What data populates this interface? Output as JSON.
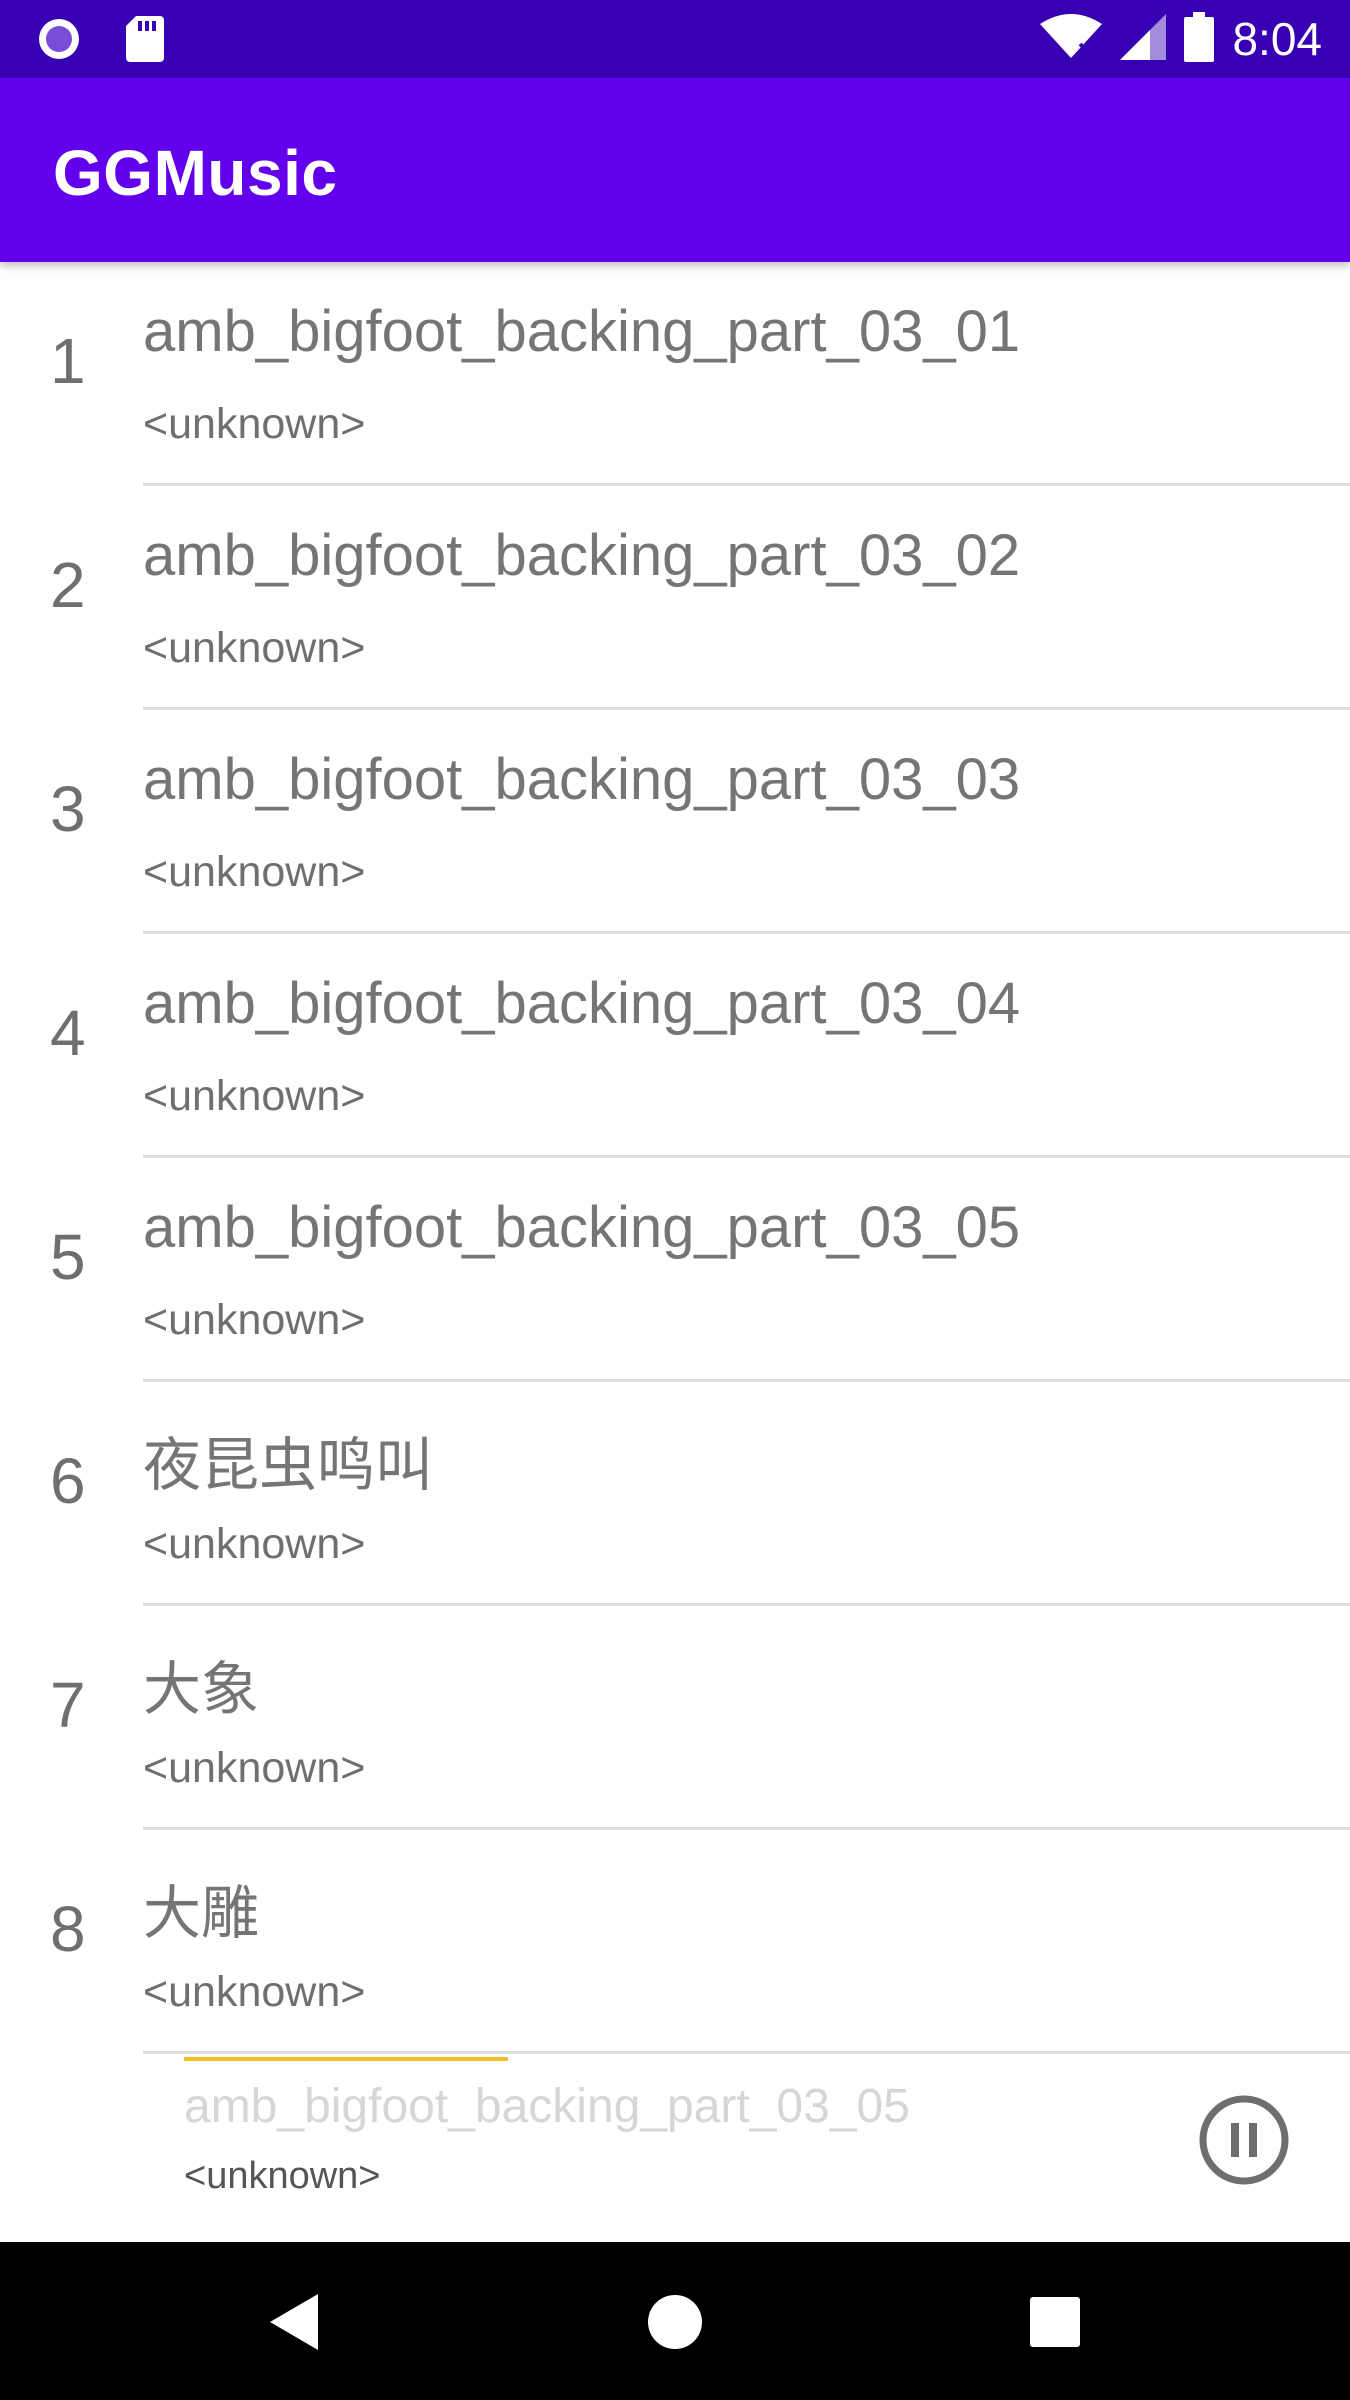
{
  "status_bar": {
    "time": "8:04",
    "icons": [
      "notification-circle-icon",
      "sd-card-icon",
      "wifi-icon",
      "signal-icon",
      "battery-icon"
    ]
  },
  "app_bar": {
    "title": "GGMusic"
  },
  "songs": [
    {
      "index": "1",
      "title": "amb_bigfoot_backing_part_03_01",
      "artist": "<unknown>"
    },
    {
      "index": "2",
      "title": "amb_bigfoot_backing_part_03_02",
      "artist": "<unknown>"
    },
    {
      "index": "3",
      "title": "amb_bigfoot_backing_part_03_03",
      "artist": "<unknown>"
    },
    {
      "index": "4",
      "title": "amb_bigfoot_backing_part_03_04",
      "artist": "<unknown>"
    },
    {
      "index": "5",
      "title": "amb_bigfoot_backing_part_03_05",
      "artist": "<unknown>"
    },
    {
      "index": "6",
      "title": "夜昆虫鸣叫",
      "artist": "<unknown>"
    },
    {
      "index": "7",
      "title": "大象",
      "artist": "<unknown>"
    },
    {
      "index": "8",
      "title": "大雕",
      "artist": "<unknown>"
    }
  ],
  "now_playing": {
    "title": "amb_bigfoot_backing_part_03_05",
    "artist": "<unknown>",
    "progress": 0.24,
    "button_icon": "pause-icon"
  },
  "nav_bar": {
    "icons": [
      "back-icon",
      "home-icon",
      "recents-icon"
    ]
  },
  "colors": {
    "status_bar": "#3700b3",
    "app_bar": "#6200ee",
    "progress": "#f2c028"
  }
}
